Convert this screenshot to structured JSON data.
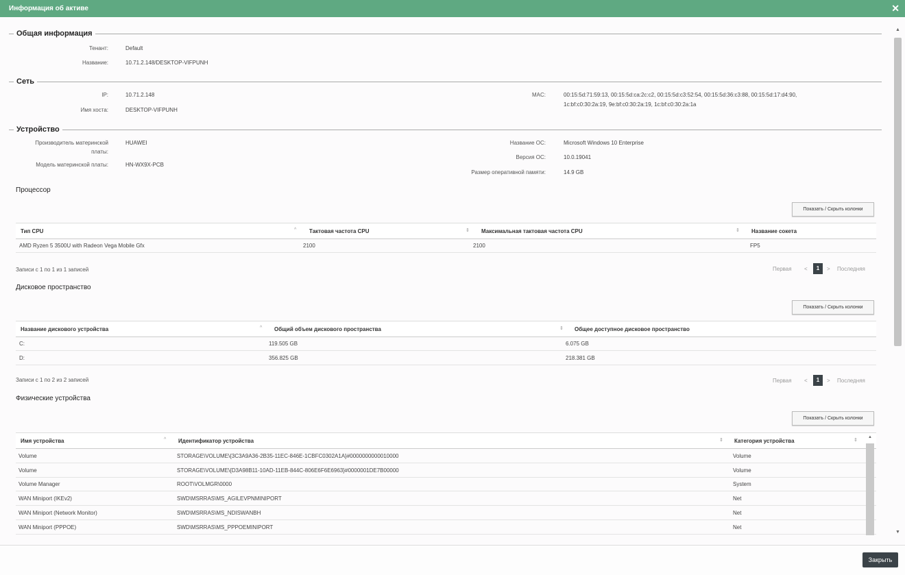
{
  "dialog": {
    "title": "Информация об активе",
    "close_icon": "✕",
    "close_button": "Закрыть"
  },
  "general": {
    "legend": "Общая информация",
    "tenant_label": "Тенант:",
    "tenant_value": "Default",
    "name_label": "Название:",
    "name_value": "10.71.2.148/DESKTOP-VIFPUNH"
  },
  "network": {
    "legend": "Сеть",
    "ip_label": "IP:",
    "ip_value": "10.71.2.148",
    "host_label": "Имя хоста:",
    "host_value": "DESKTOP-VIFPUNH",
    "mac_label": "MAC:",
    "mac_line1": "00:15:5d:71:59:13, 00:15:5d:ca:2c:c2, 00:15:5d:c3:52:54, 00:15:5d:36:c3:88, 00:15:5d:17:d4:90,",
    "mac_line2": "1c:bf:c0:30:2a:19, 9e:bf:c0:30:2a:19, 1c:bf:c0:30:2a:1a"
  },
  "device": {
    "legend": "Устройство",
    "mb_vendor_label1": "Производитель материнской",
    "mb_vendor_label2": "платы:",
    "mb_vendor_value": "HUAWEI",
    "mb_model_label": "Модель материнской платы:",
    "mb_model_value": "HN-WX9X-PCB",
    "os_name_label": "Название ОС:",
    "os_name_value": "Microsoft Windows 10 Enterprise",
    "os_ver_label": "Версия ОС:",
    "os_ver_value": "10.0.19041",
    "ram_label": "Размер оперативной памяти:",
    "ram_value": "14.9 GB"
  },
  "cpu": {
    "title": "Процессор",
    "toggle": "Показать / Скрыть колонки",
    "headers": [
      "Тип CPU",
      "Тактовая частота CPU",
      "Максимальная тактовая частота CPU",
      "Название сокета"
    ],
    "rows": [
      [
        "AMD Ryzen 5 3500U with Radeon Vega Mobile Gfx",
        "2100",
        "2100",
        "FP5"
      ]
    ],
    "info": "Записи с 1 по 1 из 1 записей"
  },
  "disk": {
    "title": "Дисковое пространство",
    "toggle": "Показать / Скрыть колонки",
    "headers": [
      "Название дискового устройства",
      "Общий объем дискового пространства",
      "Общее доступное дисковое пространство"
    ],
    "rows": [
      [
        "C:",
        "119.505 GB",
        "6.075 GB"
      ],
      [
        "D:",
        "356.825 GB",
        "218.381 GB"
      ]
    ],
    "info": "Записи с 1 по 2 из 2 записей"
  },
  "phys": {
    "title": "Физические устройства",
    "toggle": "Показать / Скрыть колонки",
    "headers": [
      "Имя устройства",
      "Идентификатор устройства",
      "Категория устройства"
    ],
    "rows": [
      [
        "Volume",
        "STORAGE\\VOLUME\\{3C3A9A36-2B35-11EC-846E-1CBFC0302A1A}#0000000000010000",
        "Volume"
      ],
      [
        "Volume",
        "STORAGE\\VOLUME\\{D3A98B11-10AD-11EB-844C-806E6F6E6963}#0000001DE7B00000",
        "Volume"
      ],
      [
        "Volume Manager",
        "ROOT\\VOLMGR\\0000",
        "System"
      ],
      [
        "WAN Miniport (IKEv2)",
        "SWD\\MSRRAS\\MS_AGILEVPNMINIPORT",
        "Net"
      ],
      [
        "WAN Miniport (Network Monitor)",
        "SWD\\MSRRAS\\MS_NDISWANBH",
        "Net"
      ],
      [
        "WAN Miniport (PPPOE)",
        "SWD\\MSRRAS\\MS_PPPOEMINIPORT",
        "Net"
      ]
    ]
  },
  "pager": {
    "first": "Первая",
    "prev": "<",
    "page": "1",
    "next": ">",
    "last": "Последняя"
  },
  "sort_icon": "⇕",
  "sort_up_icon": "^"
}
